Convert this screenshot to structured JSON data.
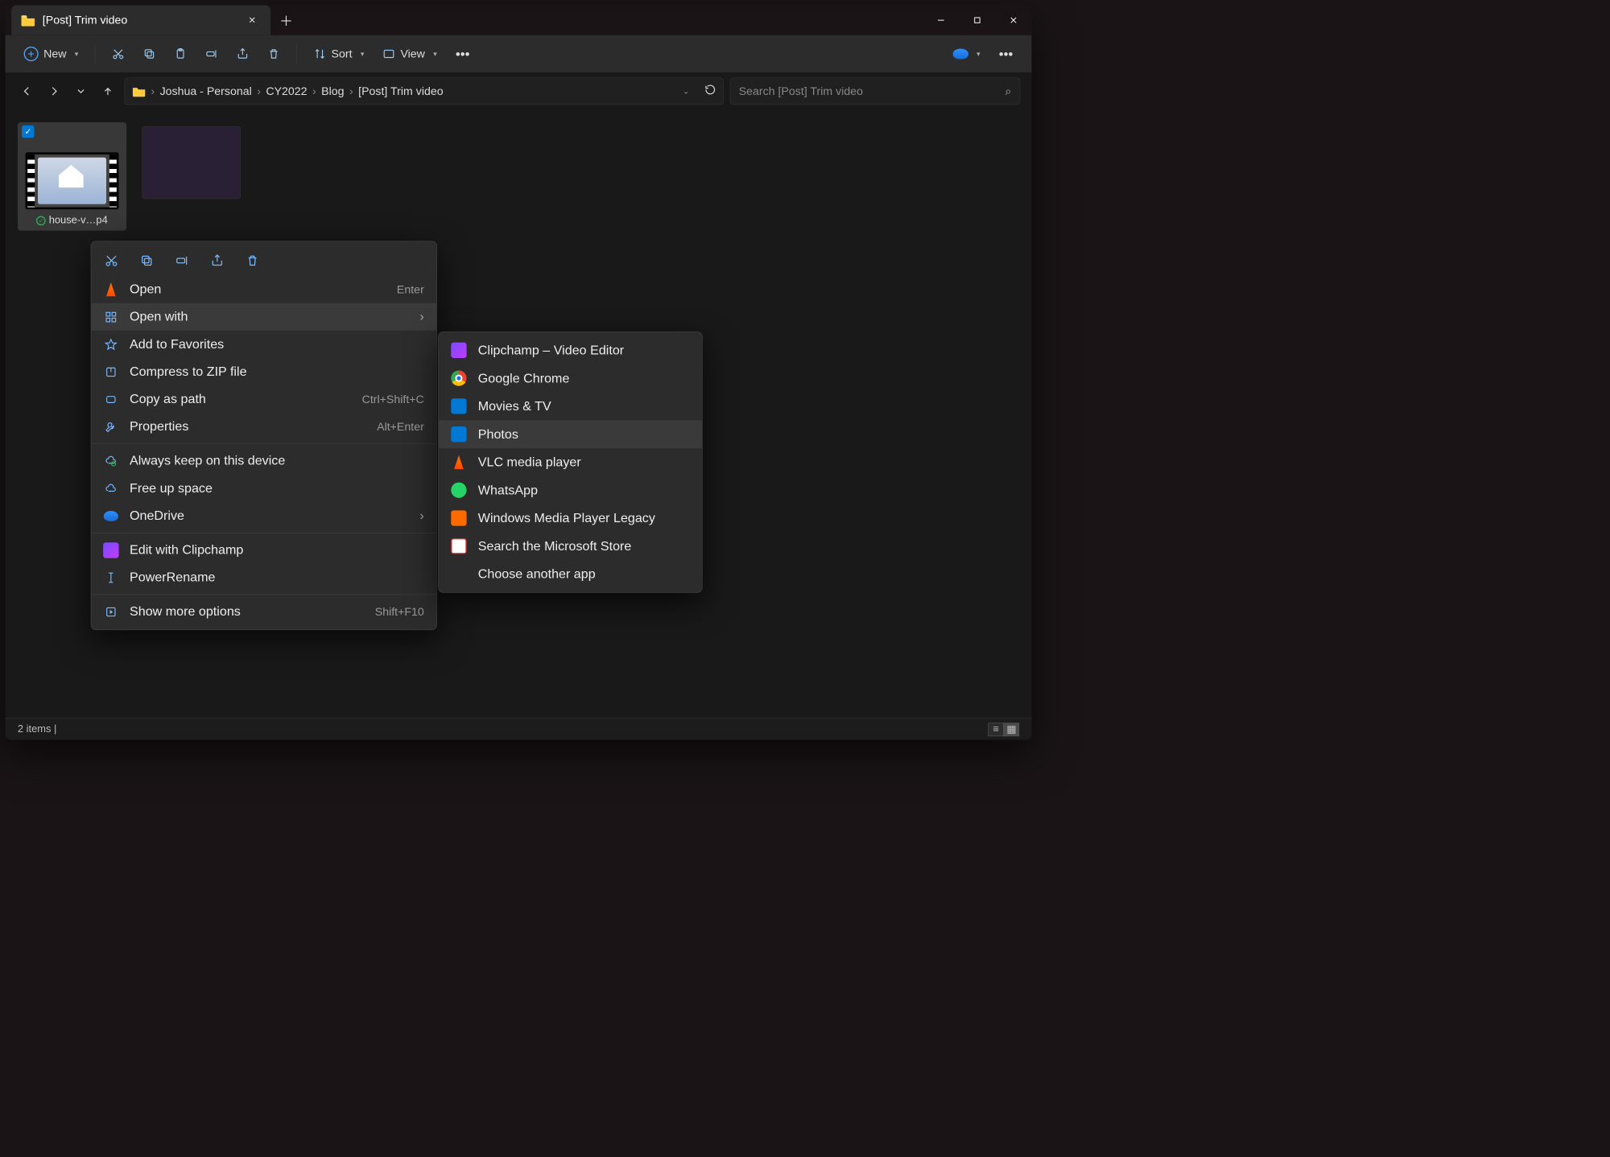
{
  "window": {
    "tab_title": "[Post] Trim video"
  },
  "toolbar": {
    "new_label": "New",
    "sort_label": "Sort",
    "view_label": "View"
  },
  "breadcrumb": {
    "items": [
      "Joshua - Personal",
      "CY2022",
      "Blog",
      "[Post] Trim video"
    ]
  },
  "search": {
    "placeholder": "Search [Post] Trim video"
  },
  "files": [
    {
      "name": "house-v…p4",
      "selected": true
    }
  ],
  "status": {
    "text": "2 items  |"
  },
  "context_menu": {
    "items": [
      {
        "label": "Open",
        "shortcut": "Enter",
        "icon": "vlc"
      },
      {
        "label": "Open with",
        "submenu": true,
        "icon": "openwith",
        "hover": true
      },
      {
        "label": "Add to Favorites",
        "icon": "star"
      },
      {
        "label": "Compress to ZIP file",
        "icon": "zip"
      },
      {
        "label": "Copy as path",
        "shortcut": "Ctrl+Shift+C",
        "icon": "path"
      },
      {
        "label": "Properties",
        "shortcut": "Alt+Enter",
        "icon": "wrench"
      },
      {
        "sep": true
      },
      {
        "label": "Always keep on this device",
        "icon": "cloudkeep"
      },
      {
        "label": "Free up space",
        "icon": "cloud"
      },
      {
        "label": "OneDrive",
        "submenu": true,
        "icon": "onedrive"
      },
      {
        "sep": true
      },
      {
        "label": "Edit with Clipchamp",
        "icon": "clipchamp"
      },
      {
        "label": "PowerRename",
        "icon": "powerrename"
      },
      {
        "sep": true
      },
      {
        "label": "Show more options",
        "shortcut": "Shift+F10",
        "icon": "more"
      }
    ]
  },
  "open_with_menu": {
    "items": [
      {
        "label": "Clipchamp – Video Editor",
        "icon": "ai-clip"
      },
      {
        "label": "Google Chrome",
        "icon": "ai-chrome"
      },
      {
        "label": "Movies & TV",
        "icon": "ai-movies"
      },
      {
        "label": "Photos",
        "icon": "ai-photos",
        "hover": true
      },
      {
        "label": "VLC media player",
        "icon": "ai-vlc"
      },
      {
        "label": "WhatsApp",
        "icon": "ai-wa"
      },
      {
        "label": "Windows Media Player Legacy",
        "icon": "ai-wmp"
      },
      {
        "label": "Search the Microsoft Store",
        "icon": "ai-ms"
      },
      {
        "label": "Choose another app",
        "icon": ""
      }
    ]
  }
}
